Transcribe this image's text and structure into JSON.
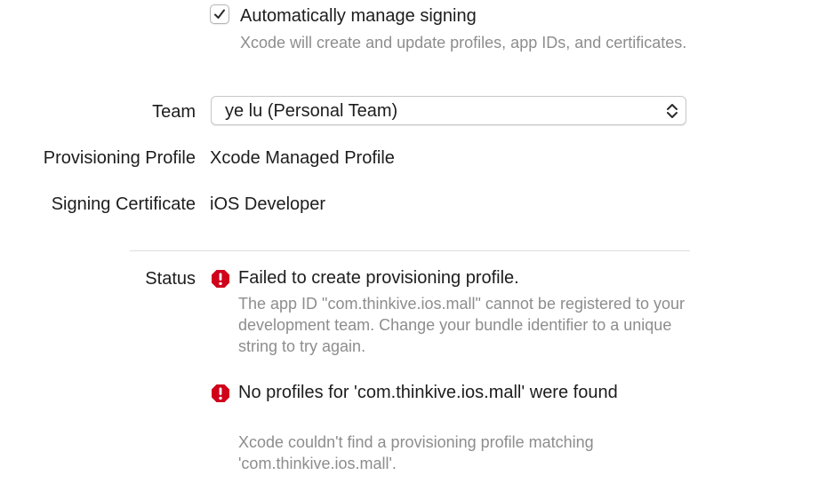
{
  "signing": {
    "auto_manage_label": "Automatically manage signing",
    "auto_manage_checked": true,
    "auto_manage_description": "Xcode will create and update profiles, app IDs, and certificates."
  },
  "team": {
    "label": "Team",
    "selected": "ye lu (Personal Team)"
  },
  "provisioning_profile": {
    "label": "Provisioning Profile",
    "value": "Xcode Managed Profile"
  },
  "signing_certificate": {
    "label": "Signing Certificate",
    "value": "iOS Developer"
  },
  "status": {
    "label": "Status",
    "errors": [
      {
        "icon": "error-icon",
        "title": "Failed to create provisioning profile.",
        "description": "The app ID \"com.thinkive.ios.mall\" cannot be registered to your development team. Change your bundle identifier to a unique string to try again."
      },
      {
        "icon": "error-icon",
        "title": "No profiles for 'com.thinkive.ios.mall' were found",
        "description": "Xcode couldn't find a provisioning profile matching 'com.thinkive.ios.mall'."
      }
    ]
  },
  "colors": {
    "error_red": "#d0021b",
    "secondary_text": "#8d8d8d"
  }
}
